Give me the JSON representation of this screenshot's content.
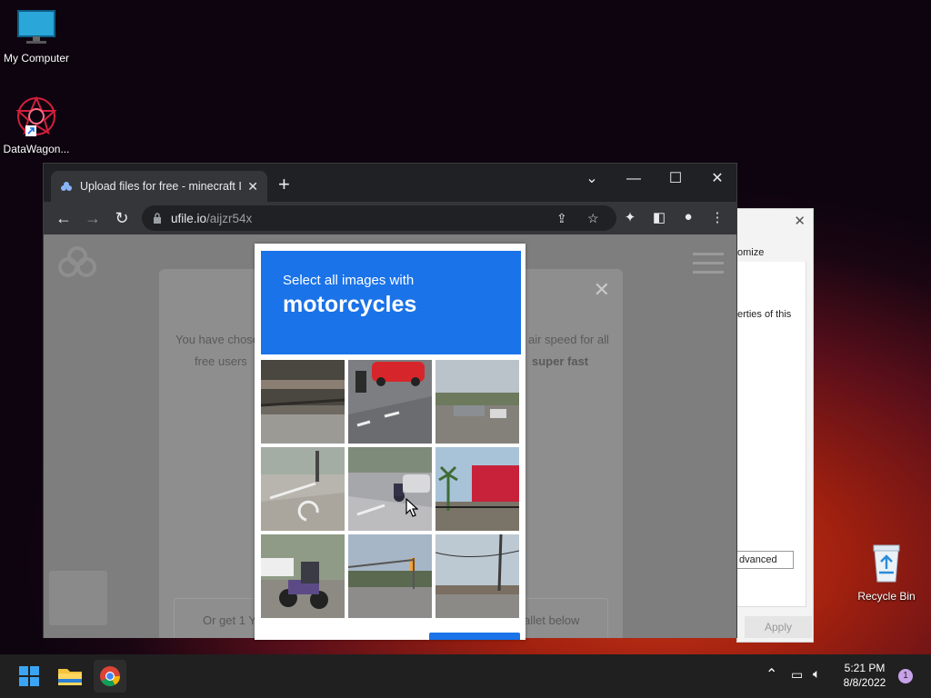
{
  "desktop": {
    "icons": [
      {
        "label": "My Computer"
      },
      {
        "label": "DataWagon..."
      },
      {
        "label": "Recycle Bin"
      }
    ]
  },
  "browser": {
    "tab_title": "Upload files for free - minecraft I",
    "address_host": "ufile.io",
    "address_path": "/aijzr54x"
  },
  "site_modal": {
    "line1_left": "You have chose",
    "line1_right": "air speed for all",
    "line2_left": "free users",
    "line2_right": "super fast",
    "bottom_left": "Or get 1 Y",
    "bottom_right": "allet below"
  },
  "dialog2": {
    "text1": "omize",
    "text2": "erties of this",
    "advanced": "dvanced",
    "apply": "Apply"
  },
  "captcha": {
    "prompt": "Select all images with",
    "target": "motorcycles"
  },
  "taskbar": {
    "time": "5:21 PM",
    "date": "8/8/2022",
    "notifications": "1"
  },
  "colors": {
    "captcha_blue": "#1a73e8",
    "taskbar": "#202020",
    "chrome_dark": "#202124"
  }
}
